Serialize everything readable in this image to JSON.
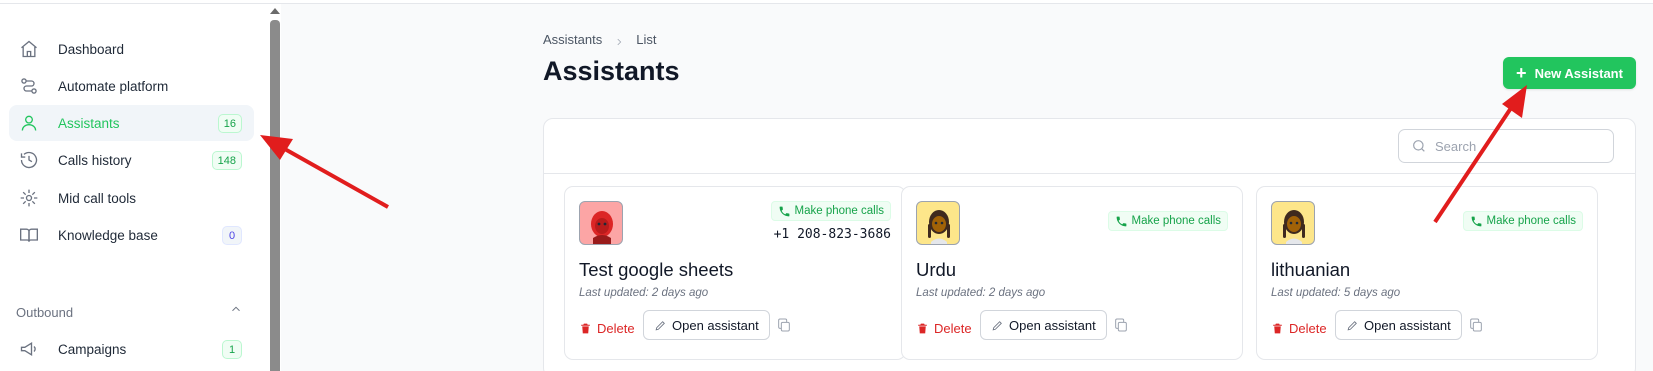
{
  "sidebar": {
    "items": [
      {
        "label": "Dashboard",
        "icon": "home-icon",
        "badge": ""
      },
      {
        "label": "Automate platform",
        "icon": "workflow-icon",
        "badge": ""
      },
      {
        "label": "Assistants",
        "icon": "user-icon",
        "badge": "16",
        "active": true
      },
      {
        "label": "Calls history",
        "icon": "history-icon",
        "badge": "148"
      },
      {
        "label": "Mid call tools",
        "icon": "tools-icon",
        "badge": ""
      },
      {
        "label": "Knowledge base",
        "icon": "book-icon",
        "badge": "0"
      }
    ],
    "section": {
      "label": "Outbound"
    },
    "outbound_items": [
      {
        "label": "Campaigns",
        "icon": "megaphone-icon",
        "badge": "1"
      }
    ]
  },
  "breadcrumb": {
    "root": "Assistants",
    "current": "List"
  },
  "page": {
    "title": "Assistants",
    "new_button_label": "New Assistant"
  },
  "search": {
    "placeholder": "Search"
  },
  "cards": [
    {
      "name": "Test google sheets",
      "chip": "Make phone calls",
      "phone": "+1 208-823-3686",
      "updated": "Last updated: 2 days ago",
      "delete_label": "Delete",
      "open_label": "Open assistant"
    },
    {
      "name": "Urdu",
      "chip": "Make phone calls",
      "phone": "",
      "updated": "Last updated: 2 days ago",
      "delete_label": "Delete",
      "open_label": "Open assistant"
    },
    {
      "name": "lithuanian",
      "chip": "Make phone calls",
      "phone": "",
      "updated": "Last updated: 5 days ago",
      "delete_label": "Delete",
      "open_label": "Open assistant"
    }
  ],
  "colors": {
    "accent": "#22c55e",
    "danger": "#dc2626",
    "annotation": "#e11d1d"
  }
}
